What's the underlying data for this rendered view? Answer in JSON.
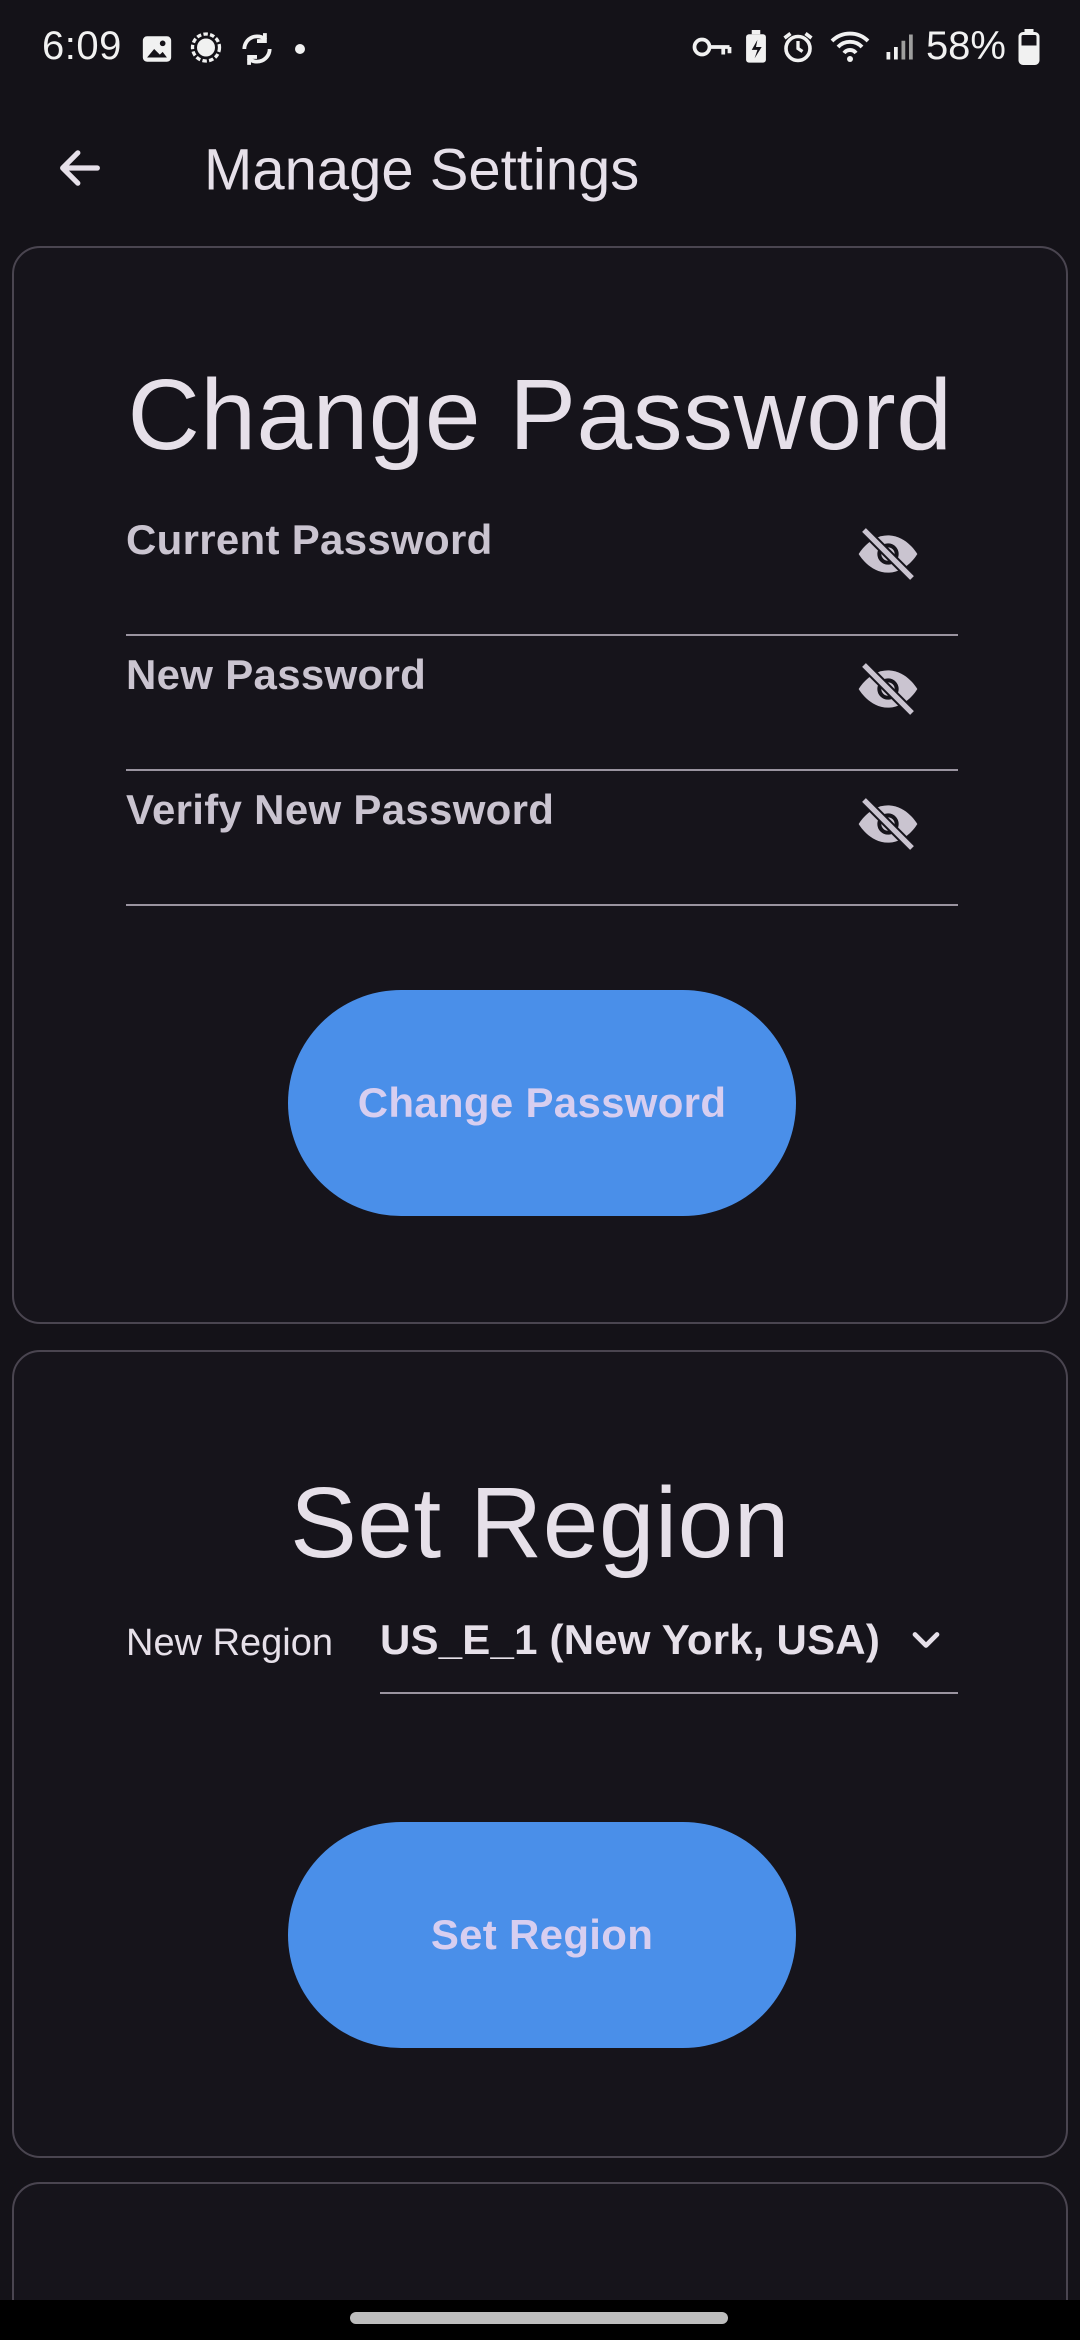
{
  "status_bar": {
    "time": "6:09",
    "left_icons": [
      "gallery-icon",
      "chat-bubble-icon",
      "sync-icon",
      "dot-icon"
    ],
    "right_icons": [
      "vpn-key-icon",
      "battery-saver-icon",
      "alarm-icon",
      "wifi-icon",
      "signal-icon"
    ],
    "battery_percent": "58%"
  },
  "app_bar": {
    "back_icon": "arrow-back-icon",
    "title": "Manage Settings"
  },
  "change_password": {
    "heading": "Change Password",
    "fields": [
      {
        "label": "Current Password",
        "icon": "visibility-off-icon"
      },
      {
        "label": "New Password",
        "icon": "visibility-off-icon"
      },
      {
        "label": "Verify New Password",
        "icon": "visibility-off-icon"
      }
    ],
    "button_label": "Change Password"
  },
  "set_region": {
    "heading": "Set Region",
    "field_label": "New Region",
    "selected_value": "US_E_1 (New York, USA)",
    "dropdown_icon": "chevron-down-icon",
    "button_label": "Set Region"
  },
  "colors": {
    "background": "#141218",
    "button": "#4a8fe9",
    "button_text": "#d7cef0",
    "card_border": "#4a4550"
  }
}
